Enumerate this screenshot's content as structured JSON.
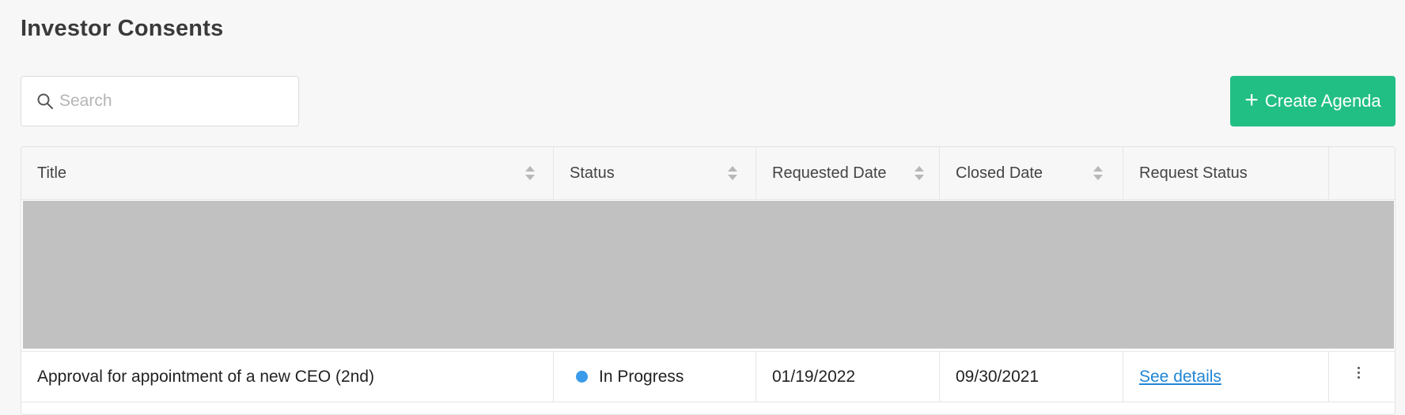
{
  "page": {
    "title": "Investor Consents"
  },
  "search": {
    "placeholder": "Search",
    "value": "",
    "icon": "search-icon"
  },
  "toolbar": {
    "create_label": "Create Agenda",
    "create_icon": "plus-icon",
    "accent_color": "#22bf85"
  },
  "table": {
    "columns": [
      {
        "label": "Title",
        "sortable": true
      },
      {
        "label": "Status",
        "sortable": true
      },
      {
        "label": "Requested Date",
        "sortable": true
      },
      {
        "label": "Closed Date",
        "sortable": true
      },
      {
        "label": "Request Status",
        "sortable": false
      },
      {
        "label": "",
        "sortable": false
      }
    ],
    "rows": [
      {
        "title": "Approval for appointment of a new CEO (2nd)",
        "status": "In Progress",
        "status_color": "#3a9bea",
        "requested_date": "01/19/2022",
        "closed_date": "09/30/2021",
        "request_status": "See details",
        "actions_icon": "more-vertical-icon"
      }
    ]
  }
}
